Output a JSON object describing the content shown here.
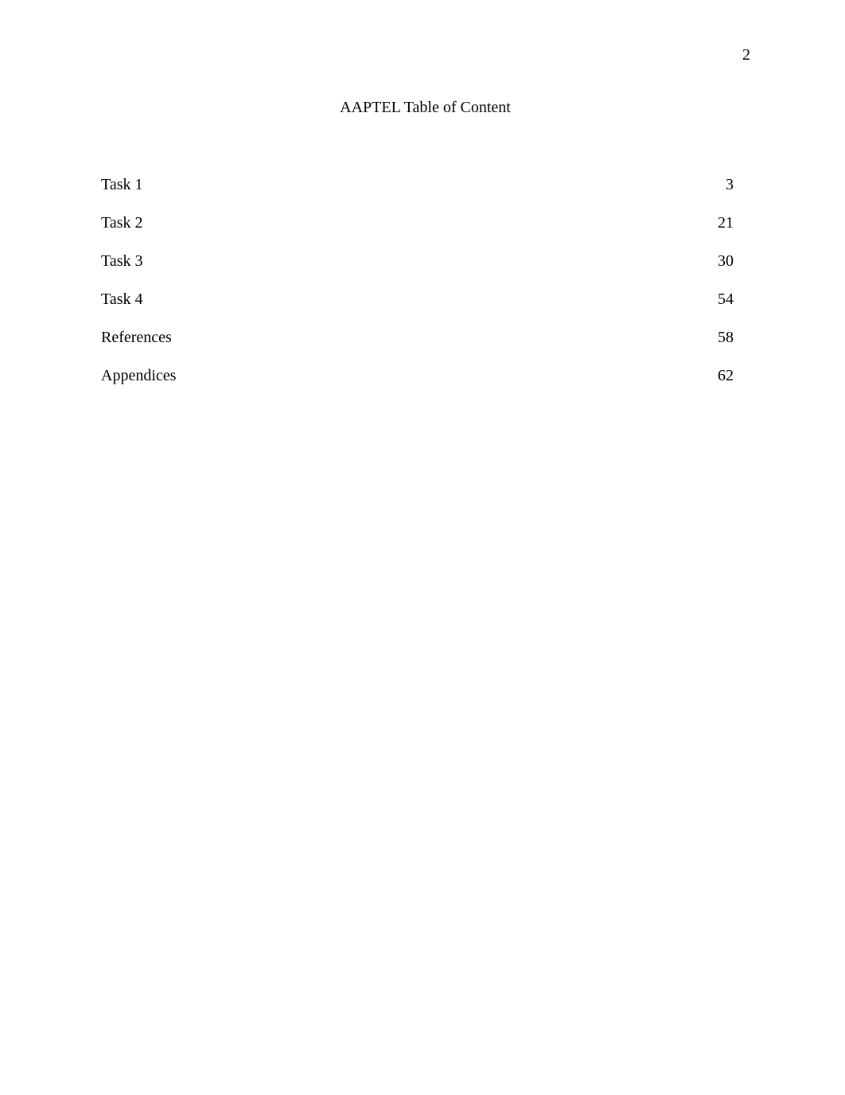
{
  "document": {
    "page_number": "2",
    "title": "AAPTEL Table of Content",
    "background_color": "#ffffff",
    "text_color": "#000000"
  },
  "toc": {
    "entries": [
      {
        "label": "Task 1",
        "page": "3"
      },
      {
        "label": "Task 2",
        "page": "21"
      },
      {
        "label": "Task 3",
        "page": "30"
      },
      {
        "label": "Task 4",
        "page": "54"
      },
      {
        "label": "References",
        "page": "58"
      },
      {
        "label": "Appendices",
        "page": "62"
      }
    ]
  }
}
